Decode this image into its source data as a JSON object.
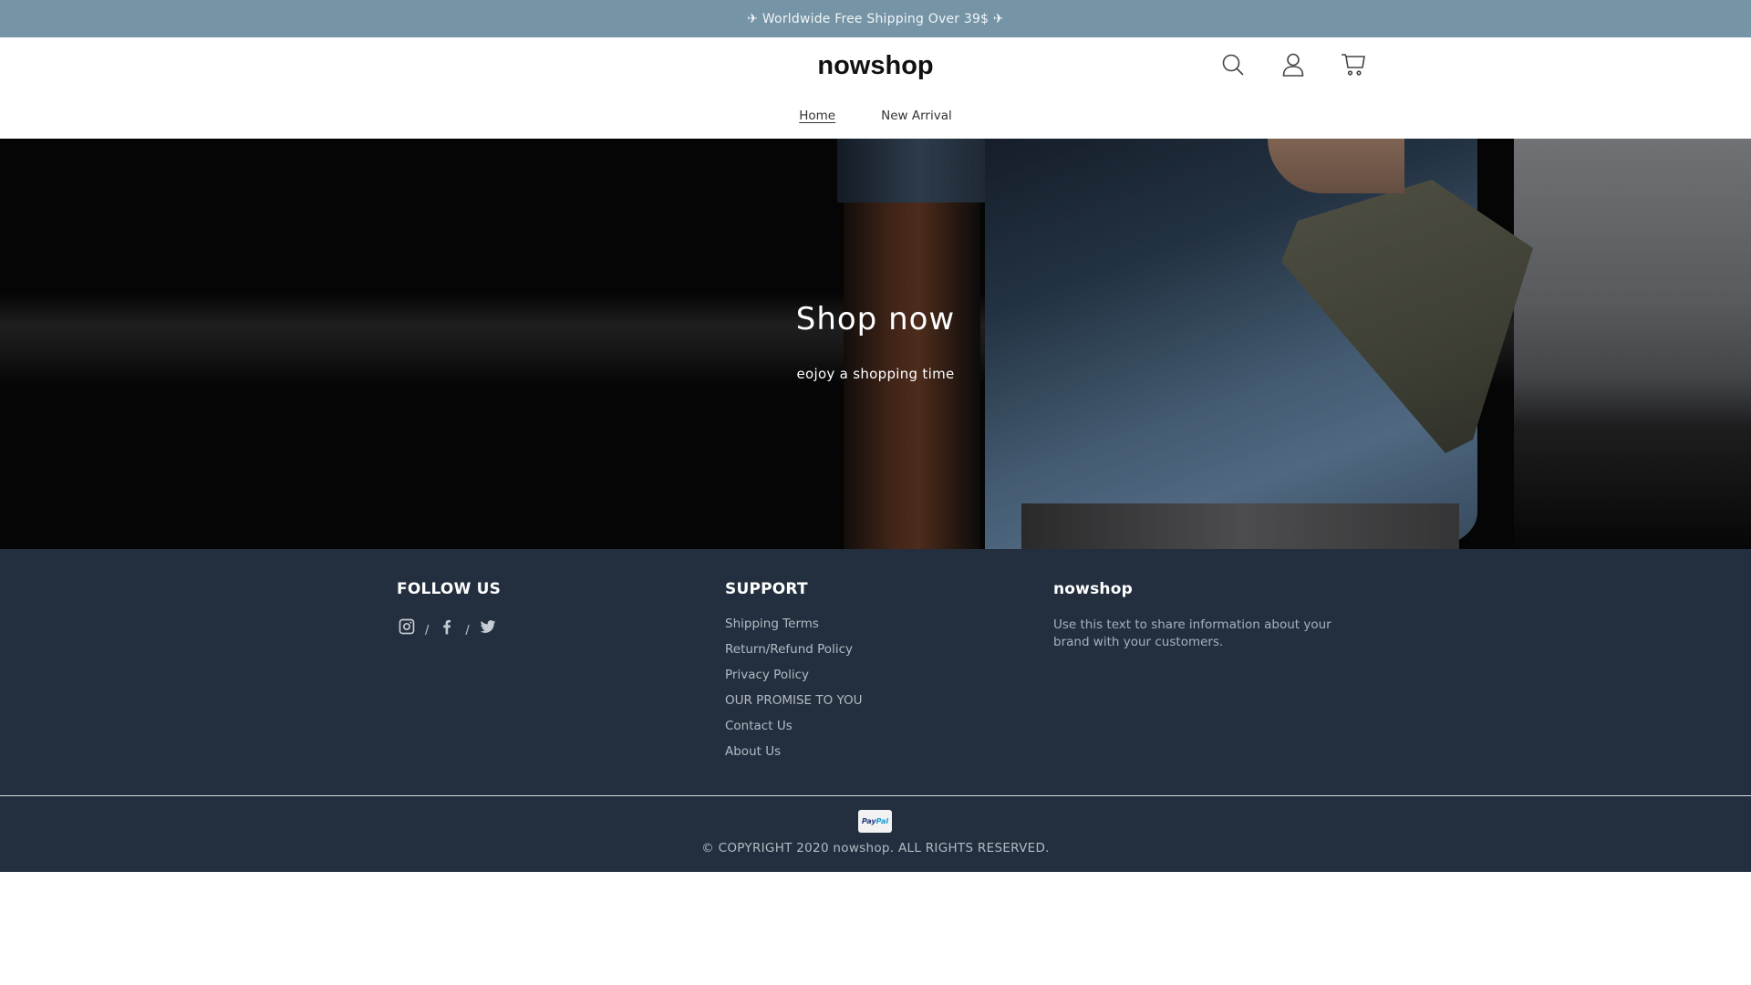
{
  "announcement": {
    "text": "✈ Worldwide Free Shipping Over 39$ ✈"
  },
  "header": {
    "logo": "nowshop",
    "icons": [
      {
        "name": "search-icon",
        "label": "Search"
      },
      {
        "name": "account-icon",
        "label": "Account"
      },
      {
        "name": "cart-icon",
        "label": "Cart"
      }
    ],
    "nav": [
      {
        "label": "Home",
        "active": true
      },
      {
        "label": "New Arrival",
        "active": false
      }
    ]
  },
  "hero": {
    "title": "Shop now",
    "subtitle": "eojoy a shopping time"
  },
  "footer": {
    "follow": {
      "heading": "FOLLOW US",
      "socials": [
        "instagram-icon",
        "facebook-icon",
        "twitter-icon"
      ],
      "separator": "/"
    },
    "support": {
      "heading": "SUPPORT",
      "links": [
        "Shipping Terms",
        "Return/Refund Policy",
        "Privacy Policy",
        "OUR PROMISE TO YOU",
        "Contact Us",
        "About Us"
      ]
    },
    "brand": {
      "heading": "nowshop",
      "text": "Use this text to share information about your brand with your customers."
    },
    "payment": {
      "pay": "Pay",
      "pal": "Pal"
    },
    "copyright": "© COPYRIGHT 2020 nowshop. ALL RIGHTS RESERVED."
  },
  "colors": {
    "announcement_bg": "#7594a6",
    "footer_bg": "#232f3e",
    "paypal_dark": "#253b80",
    "paypal_light": "#179bd7"
  }
}
